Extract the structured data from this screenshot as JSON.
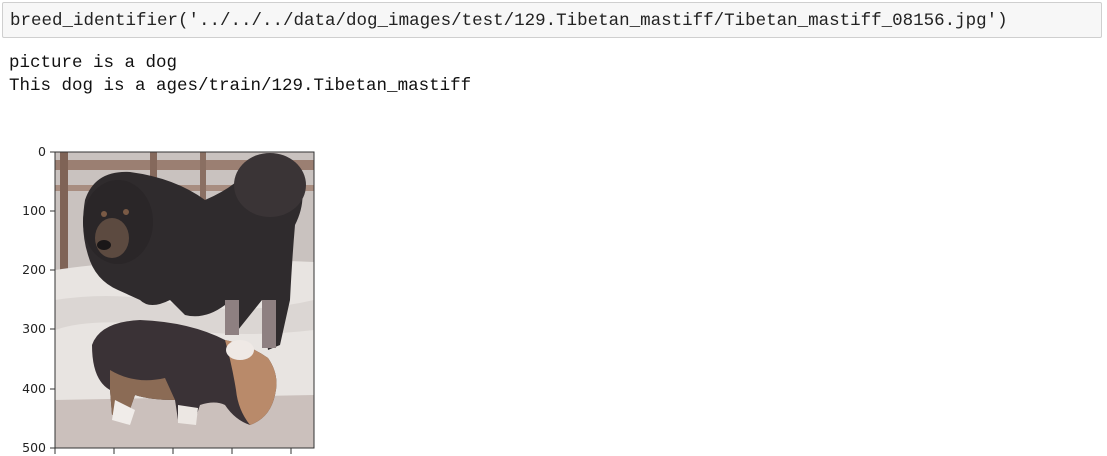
{
  "cell": {
    "code": "breed_identifier('../../../data/dog_images/test/129.Tibetan_mastiff/Tibetan_mastiff_08156.jpg')"
  },
  "output": {
    "lines": [
      "picture is a dog",
      "This dog is a ages/train/129.Tibetan_mastiff"
    ]
  },
  "figure": {
    "image_subject": "photo-two-dogs-tibetan-mastiff-in-snow",
    "y_ticks": [
      "0",
      "100",
      "200",
      "300",
      "400",
      "500"
    ],
    "colors": {
      "axes": "#333333",
      "snow": "#e9e6e2",
      "fence": "#8a6a5a",
      "dog_dark": "#2e2a2b"
    }
  }
}
